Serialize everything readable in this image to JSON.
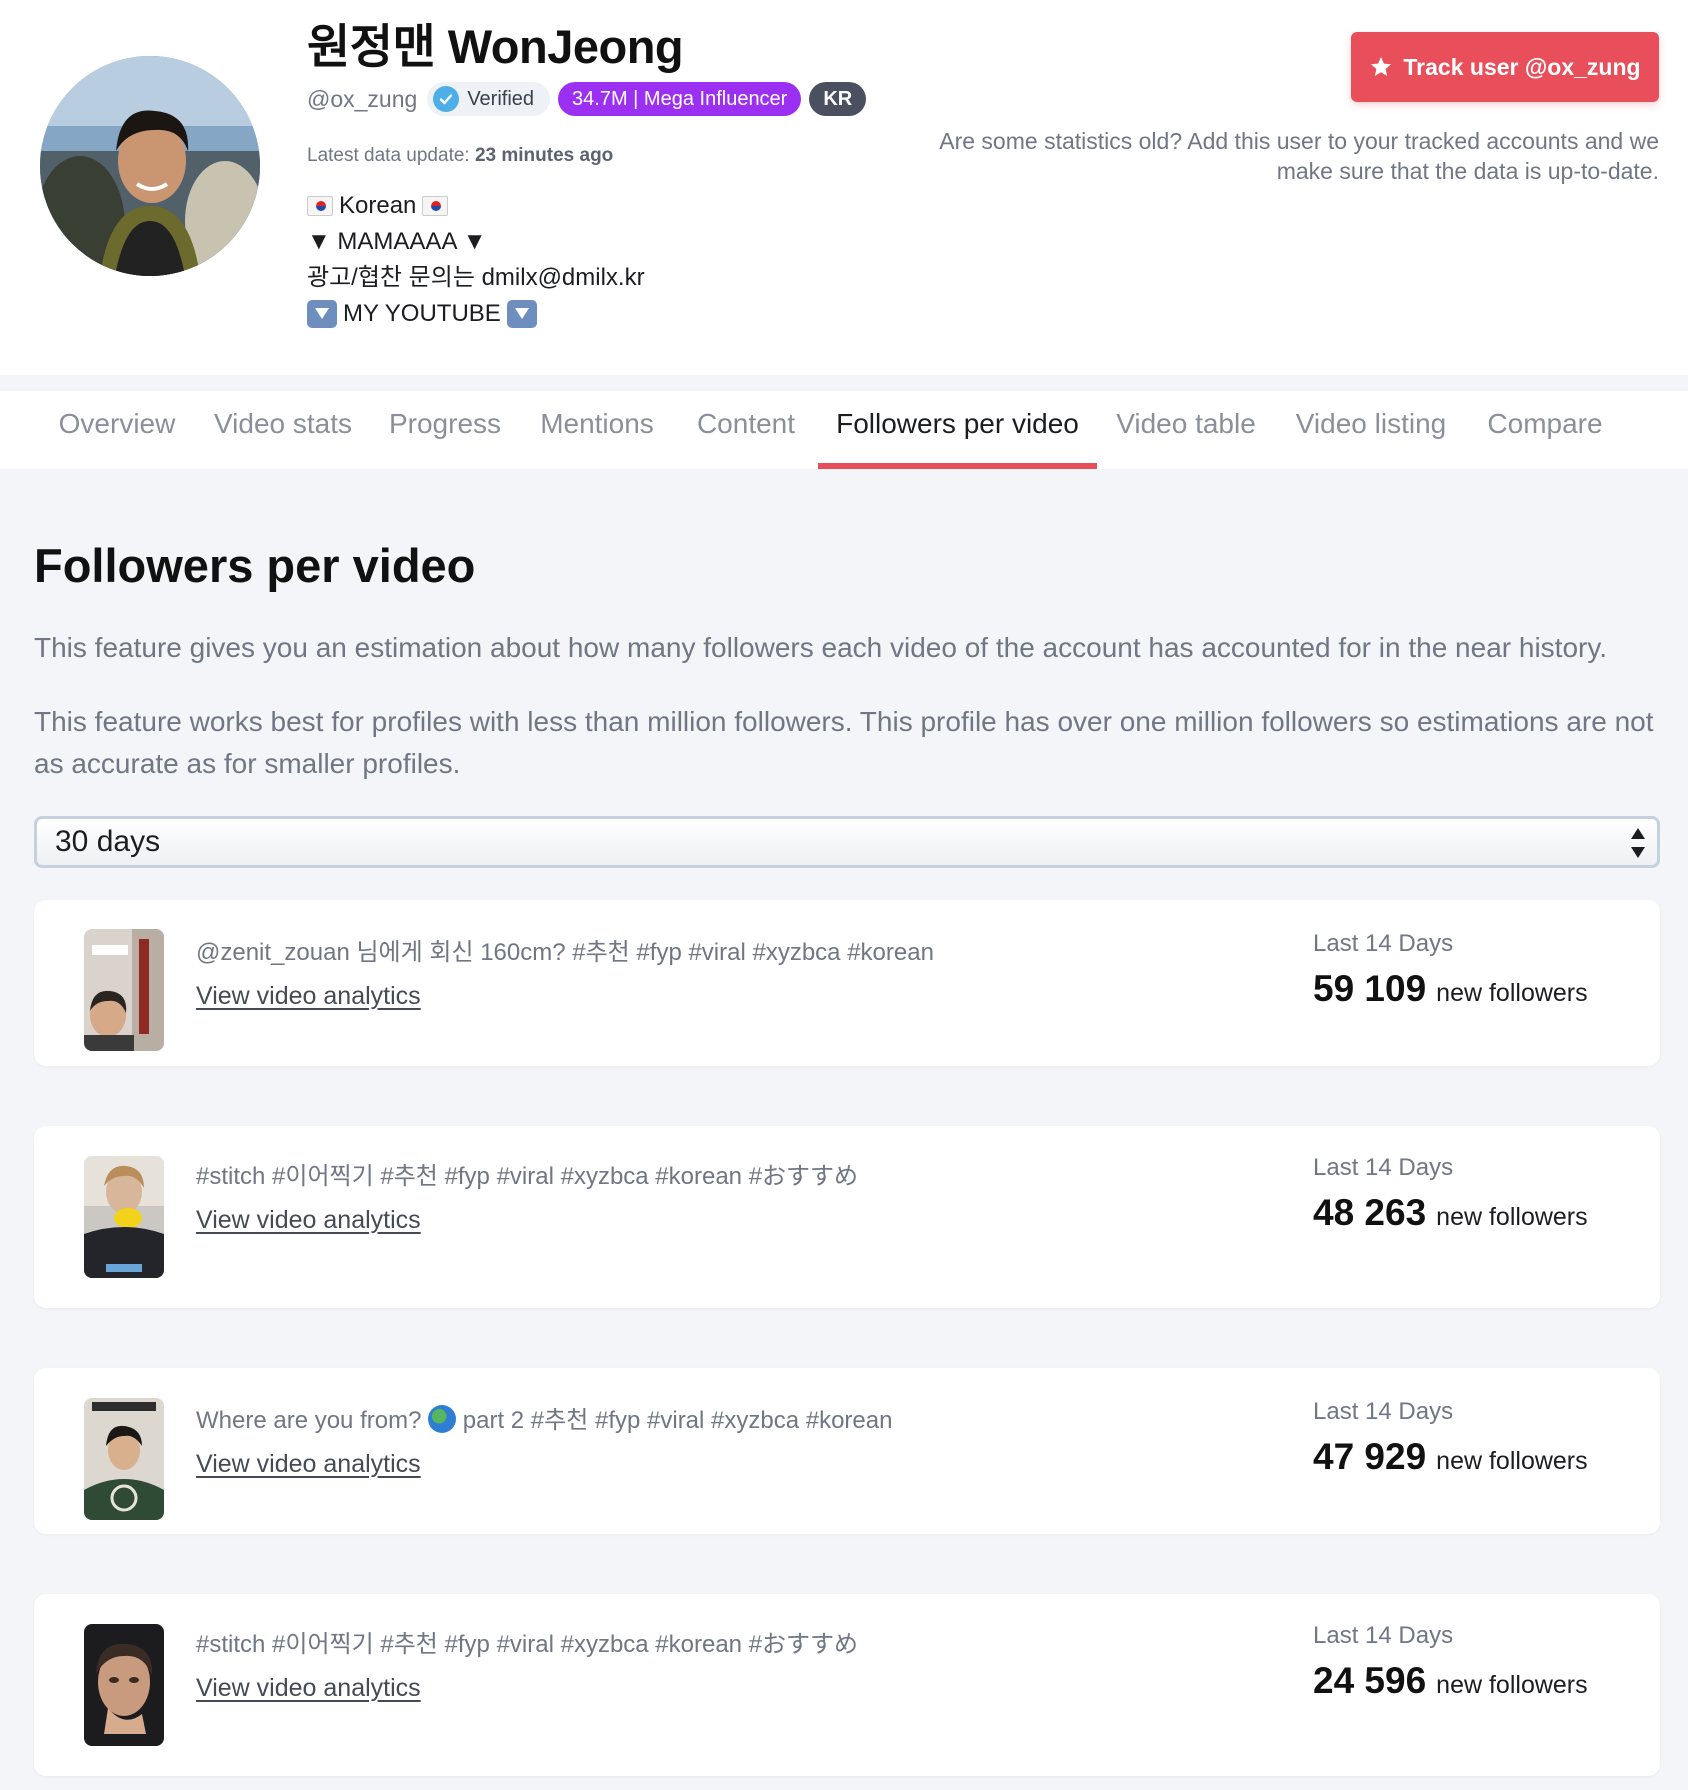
{
  "profile": {
    "display_name": "원정맨 WonJeong",
    "handle": "@ox_zung",
    "verified_label": "Verified",
    "followers_badge": "34.7M | Mega Influencer",
    "country_badge": "KR",
    "update_prefix": "Latest data update:",
    "update_value": "23 minutes ago",
    "bio": {
      "line1": "Korean",
      "line2": "▼ MAMAAAA ▼",
      "line3": "광고/협찬 문의는 dmilx@dmilx.kr",
      "line4": "MY YOUTUBE"
    },
    "bio_icons": [
      "flag-kr-icon",
      "down-arrow-box-icon"
    ]
  },
  "track": {
    "button_label": "Track user @ox_zung",
    "note": "Are some statistics old? Add this user to your tracked accounts and we make sure that the data is up-to-date."
  },
  "tabs": [
    {
      "label": "Overview"
    },
    {
      "label": "Video stats"
    },
    {
      "label": "Progress"
    },
    {
      "label": "Mentions"
    },
    {
      "label": "Content"
    },
    {
      "label": "Followers per video",
      "active": true
    },
    {
      "label": "Video table"
    },
    {
      "label": "Video listing"
    },
    {
      "label": "Compare"
    }
  ],
  "main": {
    "title": "Followers per video",
    "description": "This feature gives you an estimation about how many followers each video of the account has accounted for in the near history.",
    "warning": "This feature works best for profiles with less than million followers. This profile has over one million followers so estimations are not as accurate as for smaller profiles.",
    "range_select": {
      "value": "30 days"
    }
  },
  "videos": [
    {
      "caption": "@zenit_zouan 님에게 회신 160cm? #추천 #fyp #viral #xyzbca #korean",
      "link_label": "View video analytics",
      "period": "Last 14 Days",
      "new_followers": "59 109",
      "new_followers_label": "new followers"
    },
    {
      "caption": "#stitch #이어찍기 #추천 #fyp #viral #xyzbca #korean #おすすめ",
      "link_label": "View video analytics",
      "period": "Last 14 Days",
      "new_followers": "48 263",
      "new_followers_label": "new followers"
    },
    {
      "caption_before": "Where are you from?",
      "caption_after": "part 2 #추천 #fyp #viral #xyzbca #korean",
      "link_label": "View video analytics",
      "period": "Last 14 Days",
      "new_followers": "47 929",
      "new_followers_label": "new followers"
    },
    {
      "caption": "#stitch #이어찍기 #추천 #fyp #viral #xyzbca #korean #おすすめ",
      "link_label": "View video analytics",
      "period": "Last 14 Days",
      "new_followers": "24 596",
      "new_followers_label": "new followers"
    }
  ],
  "colors": {
    "accent": "#e94f5a",
    "influencer_badge": "#9b30f3",
    "country_badge": "#4a5060",
    "verified_check": "#4eaee8",
    "muted_text": "#707684",
    "page_bg": "#f4f5f8"
  }
}
